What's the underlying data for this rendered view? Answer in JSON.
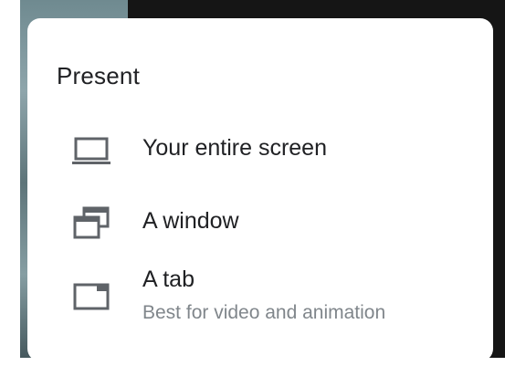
{
  "dialog": {
    "title": "Present",
    "options": [
      {
        "label": "Your entire screen",
        "icon": "laptop-icon"
      },
      {
        "label": "A window",
        "icon": "window-icon"
      },
      {
        "label": "A tab",
        "sublabel": "Best for video and animation",
        "icon": "tab-icon"
      }
    ]
  },
  "colors": {
    "text": "#202124",
    "subtext": "#80868b",
    "icon": "#5f6368"
  }
}
